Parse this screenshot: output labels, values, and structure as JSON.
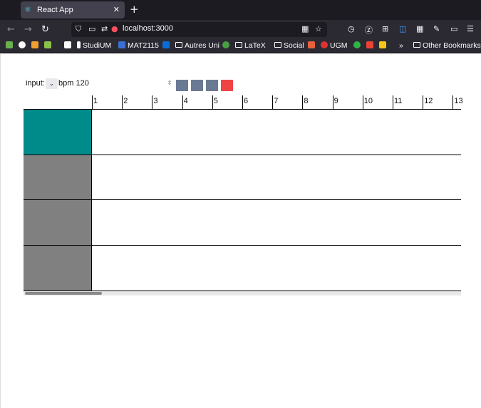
{
  "browser": {
    "tab_title": "React App",
    "url": "localhost:3000",
    "bookmarks": [
      "StudiUM",
      "MAT2115",
      "Autres Uni",
      "LaTeX",
      "Social",
      "UGM",
      "Other Bookmarks"
    ]
  },
  "controls": {
    "input_label": "input:",
    "select_chevron": "⌄",
    "bpm_label": "bpm 120",
    "buttons": [
      {
        "name": "control-button-1",
        "color": "#6b7a94"
      },
      {
        "name": "control-button-2",
        "color": "#6b7a94"
      },
      {
        "name": "control-button-3",
        "color": "#6b7a94"
      },
      {
        "name": "control-button-4",
        "color": "#ef4444"
      }
    ]
  },
  "ruler": {
    "ticks": [
      "1",
      "2",
      "3",
      "4",
      "5",
      "6",
      "7",
      "8",
      "9",
      "10",
      "11",
      "12",
      "13"
    ]
  },
  "tracks": [
    {
      "color": "#008b8b"
    },
    {
      "color": "#808080"
    },
    {
      "color": "#808080"
    },
    {
      "color": "#808080"
    }
  ],
  "colors": {
    "chrome_dark": "#1c1b22",
    "chrome_toolbar": "#2b2a33",
    "teal_track": "#008b8b",
    "gray_track": "#808080"
  }
}
